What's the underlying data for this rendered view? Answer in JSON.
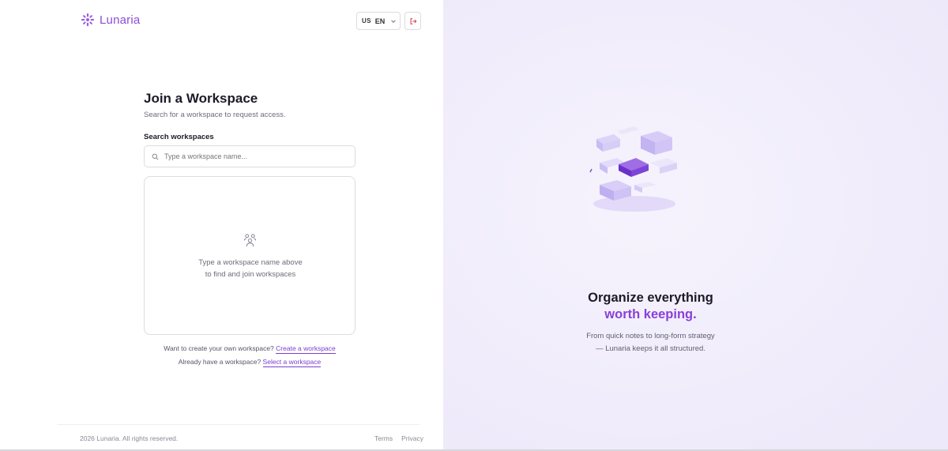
{
  "brand": {
    "name": "Lunaria",
    "accent": "#8a4fd8"
  },
  "header": {
    "language_flag": "US",
    "language_code": "EN",
    "icons": {
      "language_chevron": "chevron-down-icon",
      "logout": "logout-icon"
    }
  },
  "main": {
    "title": "Join a Workspace",
    "subtitle": "Search for a workspace to request access.",
    "search_label": "Search workspaces",
    "search_placeholder": "Type a workspace name...",
    "search_value": "",
    "empty_state": {
      "icon": "users-icon",
      "line1": "Type a workspace name above",
      "line2": "to find and join workspaces"
    },
    "create_prompt": "Want to create your own workspace?",
    "create_link": "Create a workspace",
    "select_prompt": "Already have a workspace?",
    "select_link": "Select a workspace"
  },
  "footer": {
    "copyright": "2026 Lunaria. All rights reserved.",
    "terms": "Terms",
    "privacy": "Privacy"
  },
  "hero": {
    "line1": "Organize everything",
    "line2": "worth keeping.",
    "sub1": "From quick notes to long-form strategy",
    "sub2": "— Lunaria keeps it all structured.",
    "accent": "#8a3fd9"
  }
}
